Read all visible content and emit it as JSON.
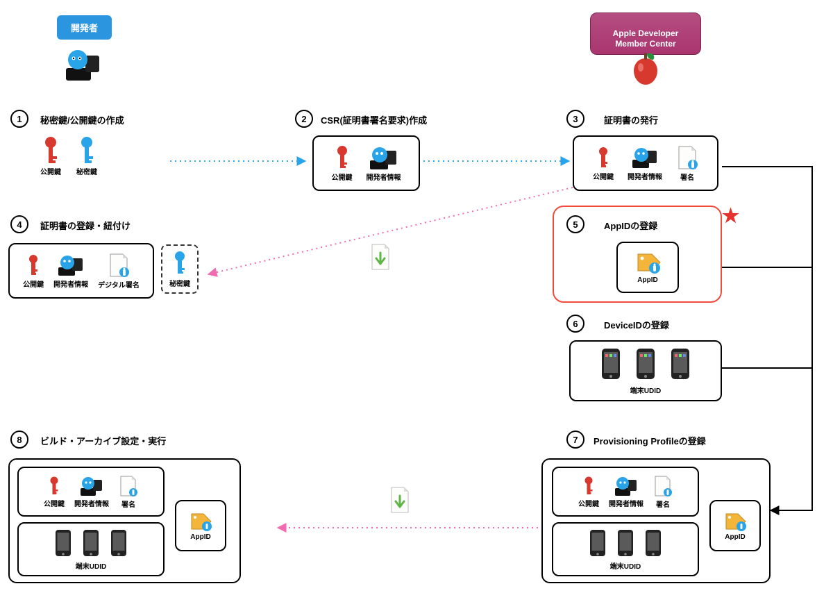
{
  "header": {
    "developer_label": "開発者",
    "apple_label": "Apple Developer\nMember Center"
  },
  "steps": {
    "s1": {
      "num": "1",
      "title": "秘密鍵/公開鍵の作成"
    },
    "s2": {
      "num": "2",
      "title": "CSR(証明書署名要求)作成"
    },
    "s3": {
      "num": "3",
      "title": "証明書の発行"
    },
    "s4": {
      "num": "4",
      "title": "証明書の登録・紐付け"
    },
    "s5": {
      "num": "5",
      "title": "AppIDの登録"
    },
    "s6": {
      "num": "6",
      "title": "DeviceIDの登録"
    },
    "s7": {
      "num": "7",
      "title": "Provisioning Profileの登録"
    },
    "s8": {
      "num": "8",
      "title": "ビルド・アーカイブ設定・実行"
    }
  },
  "labels": {
    "public_key": "公開鍵",
    "private_key": "秘密鍵",
    "dev_info": "開発者情報",
    "signature": "署名",
    "digital_signature": "デジタル署名",
    "app_id": "AppID",
    "device_udid": "端末UDID"
  },
  "marker": {
    "star": "★"
  }
}
